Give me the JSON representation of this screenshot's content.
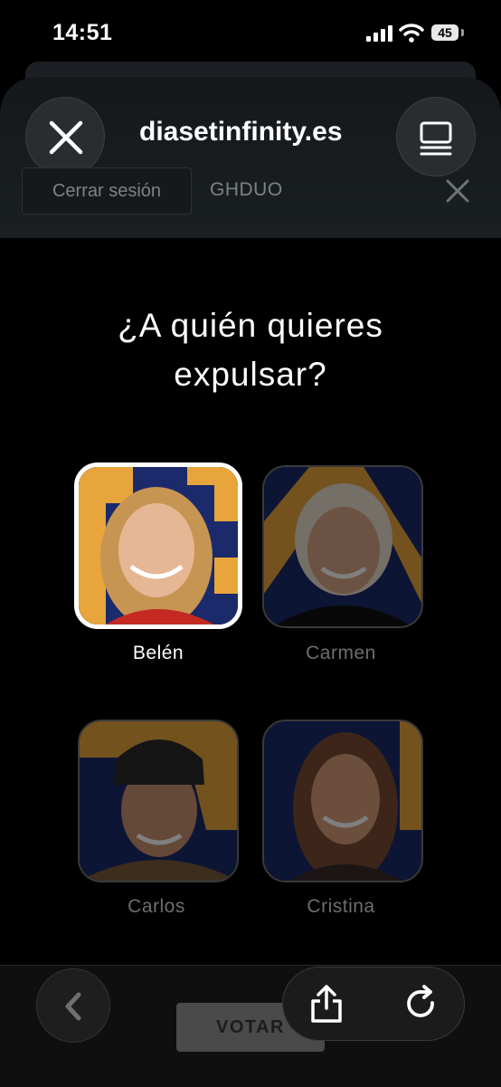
{
  "status_bar": {
    "time": "14:51",
    "battery": "45"
  },
  "browser": {
    "url": "diasetinfinity.es"
  },
  "session": {
    "logout_label": "Cerrar sesión",
    "user_code": "GHDUO"
  },
  "question": "¿A quién quieres expulsar?",
  "candidates": [
    {
      "name": "Belén",
      "selected": true
    },
    {
      "name": "Carmen",
      "selected": false
    },
    {
      "name": "Carlos",
      "selected": false
    },
    {
      "name": "Cristina",
      "selected": false
    }
  ],
  "actions": {
    "vote_label": "VOTAR"
  },
  "colors": {
    "accent_gold": "#e8a53c",
    "card_navy": "#1a2a6b"
  },
  "icons": [
    "close-icon",
    "tabs-icon",
    "share-icon",
    "reload-icon",
    "back-chevron-icon",
    "signal-icon",
    "wifi-icon",
    "battery-icon"
  ]
}
